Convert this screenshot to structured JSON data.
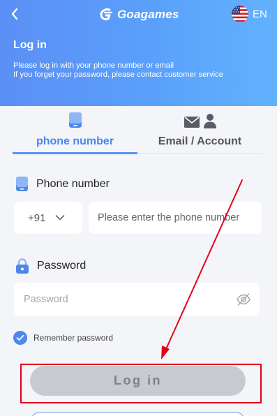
{
  "header": {
    "back_icon": "chevron-left-icon",
    "logo_text": "Goagames",
    "language_code": "EN",
    "title": "Log in",
    "subtitle_lines": [
      "Please log in with your phone number or email",
      "If you forget your password, please contact customer service"
    ]
  },
  "tabs": [
    {
      "label": "phone number",
      "icon": "phone-icon",
      "active": true
    },
    {
      "label": "Email / Account",
      "icon": "mail-user-icon",
      "active": false
    }
  ],
  "phone_section": {
    "label": "Phone number",
    "country_code": "+91",
    "placeholder": "Please enter the phone number"
  },
  "password_section": {
    "label": "Password",
    "placeholder": "Password"
  },
  "remember": {
    "label": "Remember password",
    "checked": true
  },
  "login_button": {
    "label": "Log in"
  },
  "colors": {
    "accent": "#4a86ea",
    "header_gradient_start": "#5b8ff5",
    "header_gradient_end": "#61b2fd",
    "annotation_red": "#e3001b",
    "disabled_button": "#c8cad1"
  }
}
